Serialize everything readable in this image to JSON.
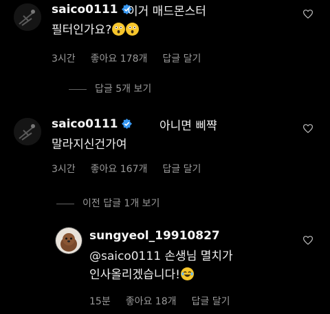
{
  "comments": [
    {
      "username": "saico0111",
      "text_line1": "이거 매드몬스터",
      "text_line2": "필터인가요?",
      "meta": {
        "time": "3시간",
        "likes": "좋아요 178개",
        "reply": "답글 달기"
      },
      "view_replies": "답글 5개 보기"
    },
    {
      "username": "saico0111",
      "text_line1": "아니면 삐쨕",
      "text_line2": "말라지신건가여",
      "meta": {
        "time": "3시간",
        "likes": "좋아요 167개",
        "reply": "답글 달기"
      },
      "view_replies": "이전 답글 1개 보기"
    }
  ],
  "reply": {
    "username": "sungyeol_19910827",
    "mention": "@saico0111",
    "text_line1_rest": " 손생님 멸치가",
    "text_line2": "인사올리겠습니다!",
    "meta": {
      "time": "15분",
      "likes": "좋아요 18개",
      "reply": "답글 달기"
    }
  },
  "icons": {
    "verified": "verified-badge-icon",
    "like": "heart-icon",
    "emoji_surprised": "astonished-face-emoji",
    "emoji_laugh": "tears-of-joy-emoji"
  },
  "colors": {
    "background": "#000000",
    "verified": "#3897f0",
    "meta": "#9a9a9a"
  }
}
